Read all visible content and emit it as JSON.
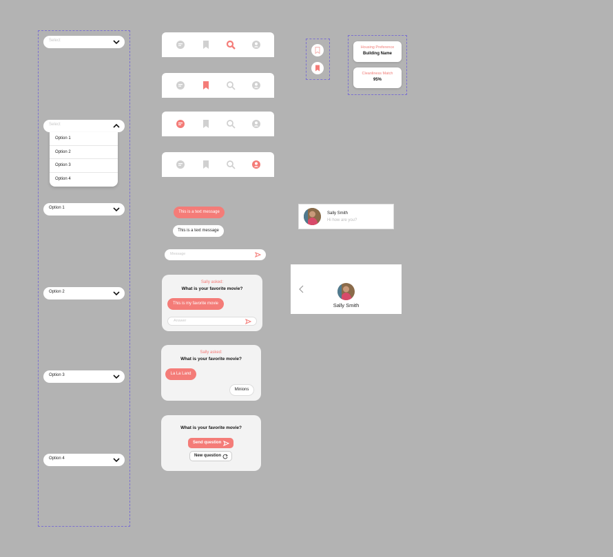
{
  "select": {
    "placeholder": "Select",
    "options": [
      "Option 1",
      "Option 2",
      "Option 3",
      "Option 4"
    ],
    "selected": [
      "Option 1",
      "Option 2",
      "Option 3",
      "Option 4"
    ]
  },
  "cards": {
    "housing_label": "Housing Preference",
    "housing_value": "Building Name",
    "clean_label": "Cleanliness Match",
    "clean_value": "95%"
  },
  "messages": {
    "sent": "This is a text message",
    "received": "This is a text message",
    "input_placeholder": "Message"
  },
  "question1": {
    "asker": "Sally asked:",
    "question": "What is your favorite movie?",
    "answer": "This is my favorite movie",
    "answer_placeholder": "Answer"
  },
  "question2": {
    "asker": "Sally asked:",
    "question": "What is your favorite movie?",
    "answer_left": "La La Land",
    "answer_right": "Minions"
  },
  "question3": {
    "question": "What is your favorite movie?",
    "send_label": "Send question",
    "new_label": "New question"
  },
  "chat_item": {
    "name": "Sally Smith",
    "preview": "Hi how are you?"
  },
  "profile_header": {
    "name": "Sally Smith"
  },
  "colors": {
    "accent": "#f47c78",
    "inactive_icon": "#d0d0d0",
    "background": "#b3b3b3"
  },
  "icons": {
    "nav": [
      "chat-icon",
      "bookmark-icon",
      "search-icon",
      "profile-icon"
    ]
  }
}
